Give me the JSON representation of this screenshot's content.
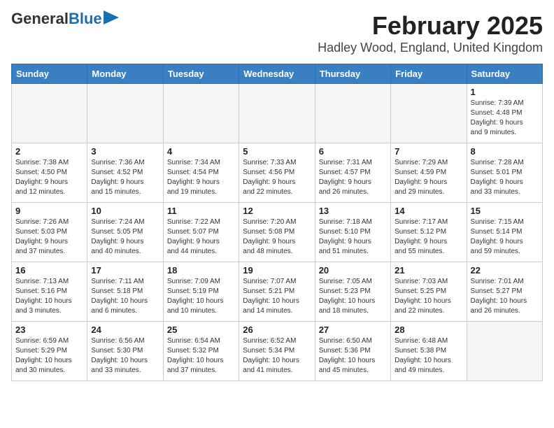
{
  "header": {
    "logo_general": "General",
    "logo_blue": "Blue",
    "title": "February 2025",
    "subtitle": "Hadley Wood, England, United Kingdom"
  },
  "calendar": {
    "days_of_week": [
      "Sunday",
      "Monday",
      "Tuesday",
      "Wednesday",
      "Thursday",
      "Friday",
      "Saturday"
    ],
    "weeks": [
      [
        {
          "day": "",
          "info": ""
        },
        {
          "day": "",
          "info": ""
        },
        {
          "day": "",
          "info": ""
        },
        {
          "day": "",
          "info": ""
        },
        {
          "day": "",
          "info": ""
        },
        {
          "day": "",
          "info": ""
        },
        {
          "day": "1",
          "info": "Sunrise: 7:39 AM\nSunset: 4:48 PM\nDaylight: 9 hours\nand 9 minutes."
        }
      ],
      [
        {
          "day": "2",
          "info": "Sunrise: 7:38 AM\nSunset: 4:50 PM\nDaylight: 9 hours\nand 12 minutes."
        },
        {
          "day": "3",
          "info": "Sunrise: 7:36 AM\nSunset: 4:52 PM\nDaylight: 9 hours\nand 15 minutes."
        },
        {
          "day": "4",
          "info": "Sunrise: 7:34 AM\nSunset: 4:54 PM\nDaylight: 9 hours\nand 19 minutes."
        },
        {
          "day": "5",
          "info": "Sunrise: 7:33 AM\nSunset: 4:56 PM\nDaylight: 9 hours\nand 22 minutes."
        },
        {
          "day": "6",
          "info": "Sunrise: 7:31 AM\nSunset: 4:57 PM\nDaylight: 9 hours\nand 26 minutes."
        },
        {
          "day": "7",
          "info": "Sunrise: 7:29 AM\nSunset: 4:59 PM\nDaylight: 9 hours\nand 29 minutes."
        },
        {
          "day": "8",
          "info": "Sunrise: 7:28 AM\nSunset: 5:01 PM\nDaylight: 9 hours\nand 33 minutes."
        }
      ],
      [
        {
          "day": "9",
          "info": "Sunrise: 7:26 AM\nSunset: 5:03 PM\nDaylight: 9 hours\nand 37 minutes."
        },
        {
          "day": "10",
          "info": "Sunrise: 7:24 AM\nSunset: 5:05 PM\nDaylight: 9 hours\nand 40 minutes."
        },
        {
          "day": "11",
          "info": "Sunrise: 7:22 AM\nSunset: 5:07 PM\nDaylight: 9 hours\nand 44 minutes."
        },
        {
          "day": "12",
          "info": "Sunrise: 7:20 AM\nSunset: 5:08 PM\nDaylight: 9 hours\nand 48 minutes."
        },
        {
          "day": "13",
          "info": "Sunrise: 7:18 AM\nSunset: 5:10 PM\nDaylight: 9 hours\nand 51 minutes."
        },
        {
          "day": "14",
          "info": "Sunrise: 7:17 AM\nSunset: 5:12 PM\nDaylight: 9 hours\nand 55 minutes."
        },
        {
          "day": "15",
          "info": "Sunrise: 7:15 AM\nSunset: 5:14 PM\nDaylight: 9 hours\nand 59 minutes."
        }
      ],
      [
        {
          "day": "16",
          "info": "Sunrise: 7:13 AM\nSunset: 5:16 PM\nDaylight: 10 hours\nand 3 minutes."
        },
        {
          "day": "17",
          "info": "Sunrise: 7:11 AM\nSunset: 5:18 PM\nDaylight: 10 hours\nand 6 minutes."
        },
        {
          "day": "18",
          "info": "Sunrise: 7:09 AM\nSunset: 5:19 PM\nDaylight: 10 hours\nand 10 minutes."
        },
        {
          "day": "19",
          "info": "Sunrise: 7:07 AM\nSunset: 5:21 PM\nDaylight: 10 hours\nand 14 minutes."
        },
        {
          "day": "20",
          "info": "Sunrise: 7:05 AM\nSunset: 5:23 PM\nDaylight: 10 hours\nand 18 minutes."
        },
        {
          "day": "21",
          "info": "Sunrise: 7:03 AM\nSunset: 5:25 PM\nDaylight: 10 hours\nand 22 minutes."
        },
        {
          "day": "22",
          "info": "Sunrise: 7:01 AM\nSunset: 5:27 PM\nDaylight: 10 hours\nand 26 minutes."
        }
      ],
      [
        {
          "day": "23",
          "info": "Sunrise: 6:59 AM\nSunset: 5:29 PM\nDaylight: 10 hours\nand 30 minutes."
        },
        {
          "day": "24",
          "info": "Sunrise: 6:56 AM\nSunset: 5:30 PM\nDaylight: 10 hours\nand 33 minutes."
        },
        {
          "day": "25",
          "info": "Sunrise: 6:54 AM\nSunset: 5:32 PM\nDaylight: 10 hours\nand 37 minutes."
        },
        {
          "day": "26",
          "info": "Sunrise: 6:52 AM\nSunset: 5:34 PM\nDaylight: 10 hours\nand 41 minutes."
        },
        {
          "day": "27",
          "info": "Sunrise: 6:50 AM\nSunset: 5:36 PM\nDaylight: 10 hours\nand 45 minutes."
        },
        {
          "day": "28",
          "info": "Sunrise: 6:48 AM\nSunset: 5:38 PM\nDaylight: 10 hours\nand 49 minutes."
        },
        {
          "day": "",
          "info": ""
        }
      ]
    ]
  }
}
